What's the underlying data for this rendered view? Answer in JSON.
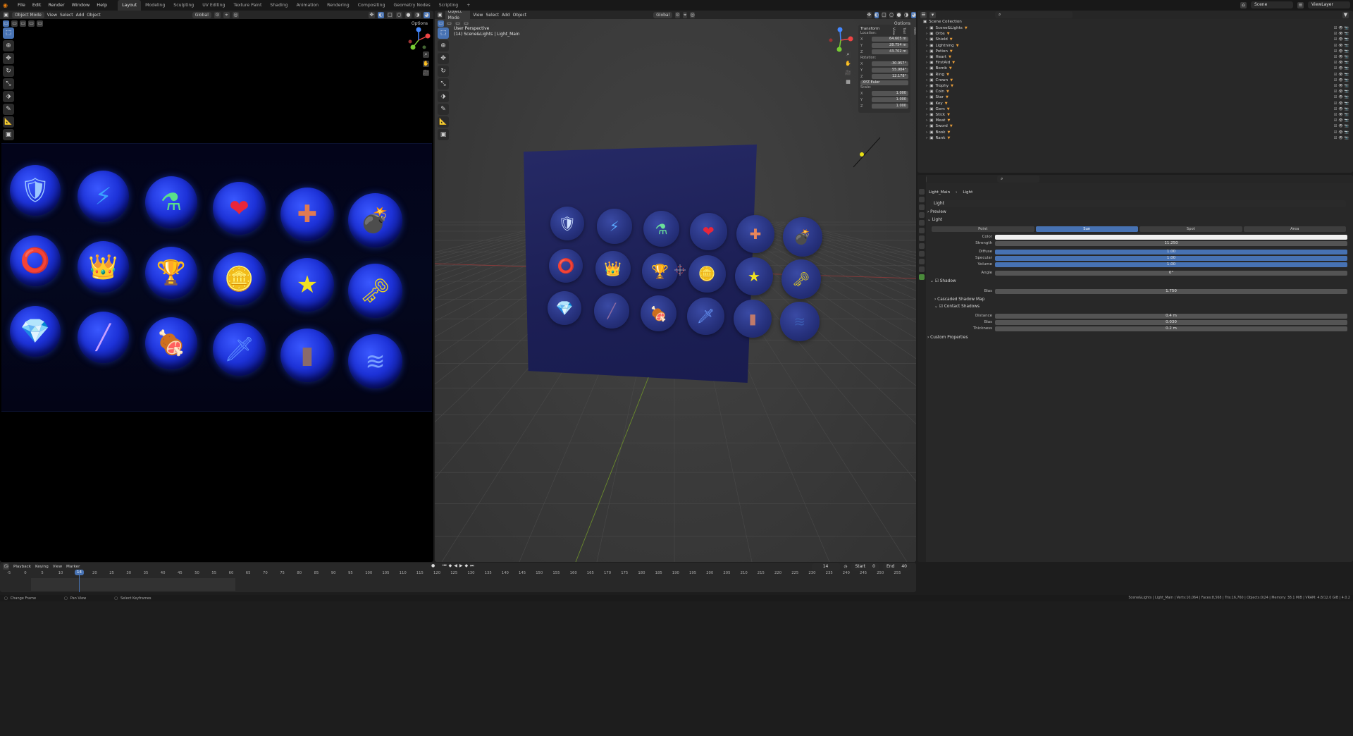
{
  "topbar": {
    "menus": [
      "File",
      "Edit",
      "Render",
      "Window",
      "Help"
    ],
    "workspaces": [
      "Layout",
      "Modeling",
      "Sculpting",
      "UV Editing",
      "Texture Paint",
      "Shading",
      "Animation",
      "Rendering",
      "Compositing",
      "Geometry Nodes",
      "Scripting",
      "+"
    ],
    "active_workspace": "Layout",
    "scene": "Scene",
    "view_layer": "ViewLayer"
  },
  "left_view": {
    "mode": "Object Mode",
    "menus": [
      "View",
      "Select",
      "Add",
      "Object"
    ],
    "orientation": "Global",
    "options": "Options",
    "icons": [
      {
        "name": "shield",
        "glyph": "🛡"
      },
      {
        "name": "lightning",
        "glyph": "⚡"
      },
      {
        "name": "potion",
        "glyph": "⚗"
      },
      {
        "name": "heart",
        "glyph": "❤"
      },
      {
        "name": "health-cross",
        "glyph": "✚"
      },
      {
        "name": "bomb",
        "glyph": "💣"
      },
      {
        "name": "ring",
        "glyph": "⭕"
      },
      {
        "name": "crown",
        "glyph": "👑"
      },
      {
        "name": "trophy",
        "glyph": "🏆"
      },
      {
        "name": "coin",
        "glyph": "🪙"
      },
      {
        "name": "star",
        "glyph": "★"
      },
      {
        "name": "key",
        "glyph": "🗝"
      },
      {
        "name": "gem",
        "glyph": "💎"
      },
      {
        "name": "stick",
        "glyph": "╱"
      },
      {
        "name": "meat",
        "glyph": "🍖"
      },
      {
        "name": "sword",
        "glyph": "🗡"
      },
      {
        "name": "book",
        "glyph": "▮"
      },
      {
        "name": "rank",
        "glyph": "≋"
      }
    ]
  },
  "right_view": {
    "mode": "Object Mode",
    "menus": [
      "View",
      "Select",
      "Add",
      "Object"
    ],
    "orientation": "Global",
    "options": "Options",
    "perspective": "User Perspective",
    "selection": "(14) Scene&Lights | Light_Main",
    "transform": {
      "title": "Transform",
      "location_label": "Location:",
      "location": [
        "X",
        "64.605 m",
        "Y",
        "28.754 m",
        "Z",
        "43.702 m"
      ],
      "rotation_label": "Rotation:",
      "rotation": [
        "X",
        "-30.957°",
        "Y",
        "55.984°",
        "Z",
        "12.178°"
      ],
      "rotation_mode": "XYZ Euler",
      "scale_label": "Scale:",
      "scale": [
        "X",
        "1.000",
        "Y",
        "1.000",
        "Z",
        "1.000"
      ]
    },
    "side_tabs": [
      "Item",
      "Tool",
      "View"
    ]
  },
  "outliner": {
    "title": "Scene Collection",
    "items": [
      "Scene&Lights",
      "Orbs",
      "Shield",
      "Lightning",
      "Potion",
      "Heart",
      "FirstAid",
      "Bomb",
      "Ring",
      "Crown",
      "Trophy",
      "Coin",
      "Star",
      "Key",
      "Gem",
      "Stick",
      "Meat",
      "Sword",
      "Book",
      "Rank"
    ]
  },
  "properties": {
    "breadcrumb": [
      "Light_Main",
      "Light"
    ],
    "datablock": "Light",
    "sections": {
      "preview": "Preview",
      "light": "Light",
      "shadow": "Shadow",
      "cascaded": "Cascaded Shadow Map",
      "contact": "Contact Shadows",
      "custom": "Custom Properties"
    },
    "light_types": [
      "Point",
      "Sun",
      "Spot",
      "Area"
    ],
    "active_light_type": "Sun",
    "rows": {
      "color_label": "Color",
      "strength_label": "Strength",
      "strength": "11.250",
      "diffuse_label": "Diffuse",
      "diffuse": "1.00",
      "specular_label": "Specular",
      "specular": "1.00",
      "volume_label": "Volume",
      "volume": "1.00",
      "angle_label": "Angle",
      "angle": "0°",
      "bias_label": "Bias",
      "bias": "1.750",
      "distance_label": "Distance",
      "distance": "0.4 m",
      "cbias_label": "Bias",
      "cbias": "0.030",
      "thickness_label": "Thickness",
      "thickness": "0.2 m"
    }
  },
  "timeline": {
    "menus": [
      "Playback",
      "Keying",
      "View",
      "Marker"
    ],
    "current_frame": "14",
    "start_label": "Start",
    "start": "0",
    "end_label": "End",
    "end": "40",
    "ticks": [
      "-5",
      "0",
      "5",
      "10",
      "15",
      "20",
      "25",
      "30",
      "35",
      "40",
      "45",
      "50",
      "55",
      "60",
      "65",
      "70",
      "75",
      "80",
      "85",
      "90",
      "95",
      "100",
      "105",
      "110",
      "115",
      "120",
      "125",
      "130",
      "135",
      "140",
      "145",
      "150",
      "155",
      "160",
      "165",
      "170",
      "175",
      "180",
      "185",
      "190",
      "195",
      "200",
      "205",
      "210",
      "215",
      "220",
      "225",
      "230",
      "235",
      "240",
      "245",
      "250",
      "255"
    ]
  },
  "statusbar": {
    "hints": [
      "Change Frame",
      "Pan View",
      "Select Keyframes"
    ],
    "stats": "Scene&Lights | Light_Main | Verts:10,064 | Faces:8,568 | Tris:16,760 | Objects:0/24 | Memory: 38.1 MiB | VRAM: 4.8/12.0 GiB | 4.0.2"
  },
  "colors": {
    "accent": "#4772b3",
    "orange": "#e87d0d",
    "bubble": "#1d32d8"
  }
}
